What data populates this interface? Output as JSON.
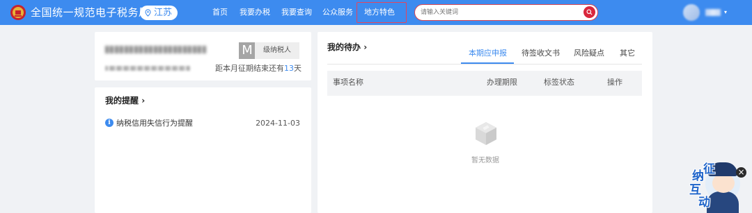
{
  "header": {
    "site_title": "全国统一规范电子税务局",
    "region": "江苏",
    "nav": [
      {
        "label": "首页"
      },
      {
        "label": "我要办税"
      },
      {
        "label": "我要查询"
      },
      {
        "label": "公众服务"
      },
      {
        "label": "地方特色"
      }
    ],
    "search_placeholder": "请输入关键词",
    "colors": {
      "bar": "#3d8bef",
      "search_border": "#d9434e",
      "highlight_box": "#e8445a"
    }
  },
  "taxpayer_card": {
    "badge_letter": "M",
    "level_label": "级纳税人",
    "deadline_prefix": "距本月征期结束还有",
    "deadline_days": "13",
    "deadline_suffix": "天"
  },
  "reminders": {
    "title": "我的提醒",
    "arrow": "›",
    "items": [
      {
        "icon": "info-icon",
        "text": "纳税信用失信行为提醒",
        "date": "2024-11-03"
      }
    ]
  },
  "todo": {
    "title": "我的待办",
    "arrow": "›",
    "tabs": [
      {
        "label": "本期应申报",
        "active": true
      },
      {
        "label": "待签收文书",
        "active": false
      },
      {
        "label": "风险疑点",
        "active": false
      },
      {
        "label": "其它",
        "active": false
      }
    ],
    "columns": [
      "事项名称",
      "办理期限",
      "标签状态",
      "操作"
    ],
    "empty_text": "暂无数据"
  },
  "helper": {
    "chars": [
      "征",
      "纳",
      "互",
      "动"
    ],
    "close": "×"
  }
}
